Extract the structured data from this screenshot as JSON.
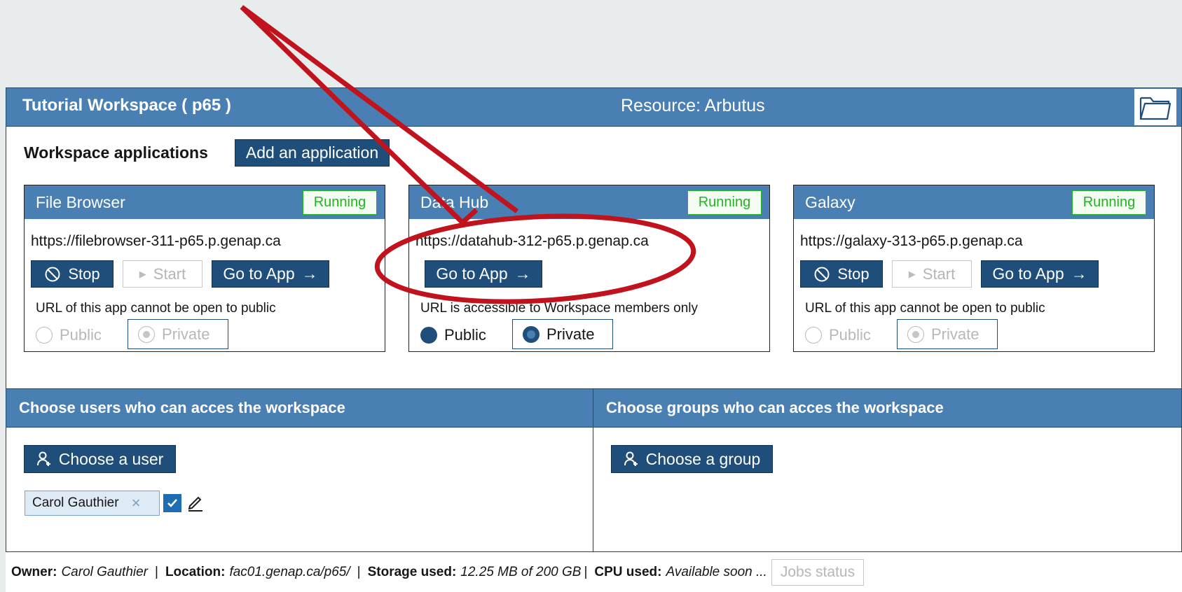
{
  "workspace": {
    "title": "Tutorial Workspace ( p65 )",
    "resource": "Resource: Arbutus",
    "folder_icon": "folder-icon"
  },
  "apps_section": {
    "label": "Workspace applications",
    "add_button": "Add an application"
  },
  "apps": [
    {
      "name": "File Browser",
      "status": "Running",
      "url": "https://filebrowser-311-p65.p.genap.ca",
      "stop_label": "Stop",
      "start_label": "Start",
      "goto_label": "Go to App",
      "note": "URL of this app cannot be open to public",
      "public_label": "Public",
      "private_label": "Private"
    },
    {
      "name": "Data Hub",
      "status": "Running",
      "url": "https://datahub-312-p65.p.genap.ca",
      "goto_label": "Go to App",
      "note": "URL is accessible to Workspace members only",
      "public_label": "Public",
      "private_label": "Private"
    },
    {
      "name": "Galaxy",
      "status": "Running",
      "url": "https://galaxy-313-p65.p.genap.ca",
      "stop_label": "Stop",
      "start_label": "Start",
      "goto_label": "Go to App",
      "note": "URL of this app cannot be open to public",
      "public_label": "Public",
      "private_label": "Private"
    }
  ],
  "users_panel": {
    "title": "Choose users who can acces the workspace",
    "button": "Choose a user",
    "chip": "Carol Gauthier",
    "chip_remove": "×"
  },
  "groups_panel": {
    "title": "Choose groups who can acces the workspace",
    "button": "Choose a group"
  },
  "footer": {
    "owner_label": "Owner:",
    "owner": "Carol Gauthier",
    "location_label": "Location:",
    "location": "fac01.genap.ca/p65/",
    "storage_label": "Storage used:",
    "storage": "12.25 MB of 200 GB",
    "cpu_label": "CPU used:",
    "cpu": "Available soon ...",
    "jobs_button": "Jobs status"
  },
  "colors": {
    "header_blue": "#4a7fb3",
    "button_navy": "#1e4e79",
    "running_green": "#23b323",
    "annotation_red": "#c0131d"
  }
}
